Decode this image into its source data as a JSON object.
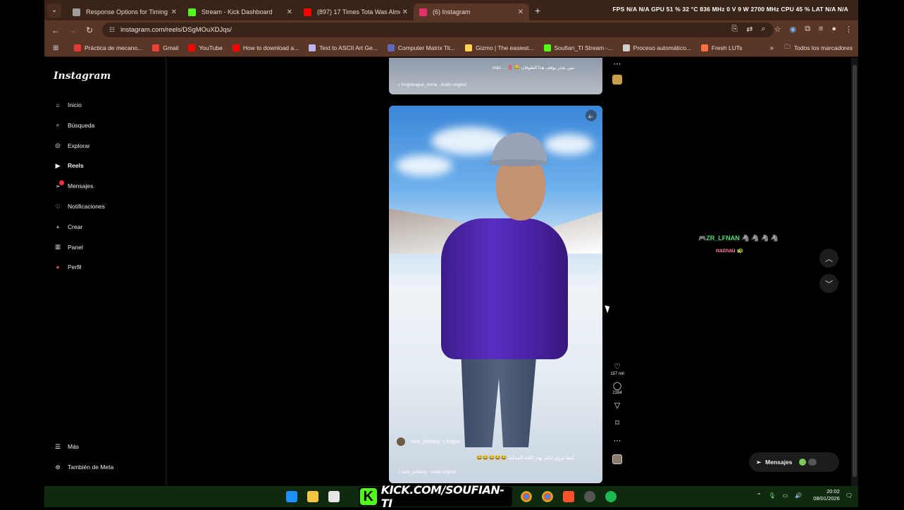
{
  "browser": {
    "tabs": [
      {
        "label": "Response Options for Timing",
        "color": "#9e9e9e"
      },
      {
        "label": "Stream - Kick Dashboard",
        "color": "#53fc18"
      },
      {
        "label": "(897) 17 Times Tota Was Almos",
        "color": "#ff0000"
      },
      {
        "label": "(6) Instagram",
        "color": "#e1306c",
        "active": true
      }
    ],
    "hud": "FPS  N/A  N/A    GPU 51 % 32 °C 836 MHz  0 V  9 W  2700 MHz    CPU 45 %    LAT N/A  N/A",
    "url": "instagram.com/reels/DSgMOuXDJqs/",
    "bookmarks": [
      {
        "label": "Práctica de mecano...",
        "color": "#e53935"
      },
      {
        "label": "Gmail",
        "color": "#ea4335"
      },
      {
        "label": "YouTube",
        "color": "#ff0000"
      },
      {
        "label": "How to download a...",
        "color": "#ff0000"
      },
      {
        "label": "Text to ASCII Art Ge...",
        "color": "#bdb5f0"
      },
      {
        "label": "Computer Matrix Tit...",
        "color": "#5c6bc0"
      },
      {
        "label": "Gizmo | The easiest...",
        "color": "#ffd54f"
      },
      {
        "label": "Soufian_TI Stream -...",
        "color": "#53fc18"
      },
      {
        "label": "Proceso automático...",
        "color": "#cfcfcf"
      },
      {
        "label": "Fresh LUTs",
        "color": "#ff7043"
      }
    ],
    "bookmarks_all": "Todos los marcadores"
  },
  "instagram": {
    "logo": "Instagram",
    "nav": [
      {
        "label": "Inicio",
        "icon": "home-icon",
        "glyph": "⌂"
      },
      {
        "label": "Búsqueda",
        "icon": "search-icon",
        "glyph": "⌕"
      },
      {
        "label": "Explorar",
        "icon": "compass-icon",
        "glyph": "◎"
      },
      {
        "label": "Reels",
        "icon": "reels-icon",
        "glyph": "▶",
        "active": true
      },
      {
        "label": "Mensajes",
        "icon": "messages-icon",
        "glyph": "➢",
        "badge": "4"
      },
      {
        "label": "Notificaciones",
        "icon": "heart-icon",
        "glyph": "♡"
      },
      {
        "label": "Crear",
        "icon": "plus-icon",
        "glyph": "+"
      },
      {
        "label": "Panel",
        "icon": "dashboard-icon",
        "glyph": "▥"
      },
      {
        "label": "Perfil",
        "icon": "avatar-icon",
        "glyph": "●"
      }
    ],
    "more": "Más",
    "meta": "También de Meta",
    "prev_reel": {
      "caption": "مين يقدر يوقف هذا الطوفان 😂 ‼️ ... más",
      "audio": "♫ kingsleague_mena · Audio original"
    },
    "reel": {
      "username": "tarik_jabbariy",
      "follow": "• Seguir",
      "caption": "أتبقا تدوي ليكم بهاد اللغة المحلية 😂😂😂😂😂",
      "audio": "♫ tarik_jabbariy · Audio original",
      "likes": "157 mil",
      "comments": "2164"
    },
    "messages_pill": "Mensajes"
  },
  "overlay": {
    "chat_user": "🎮ZR_LFNAN 🦓 🦓 🦓 🦓",
    "chat_line": "naznau 🐢"
  },
  "taskbar": {
    "kick": "KICK.COM/SOUFIAN-TI",
    "time": "20:02",
    "date": "08/01/2026"
  }
}
